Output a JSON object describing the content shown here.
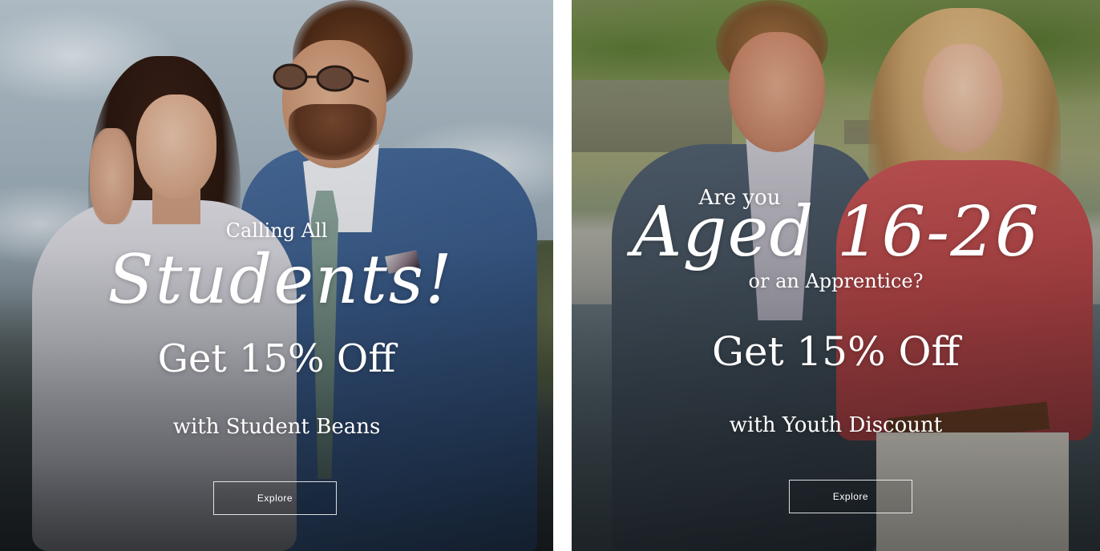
{
  "promos": [
    {
      "eyebrow": "Calling All",
      "headline": "Students!",
      "offer": "Get 15% Off",
      "subtext": "with Student Beans",
      "button_label": "Explore"
    },
    {
      "eyebrow": "Are you",
      "headline": "Aged 16-26",
      "eyebrow_2": "or an Apprentice?",
      "offer": "Get 15% Off",
      "subtext": "with Youth Discount",
      "button_label": "Explore"
    }
  ],
  "colors": {
    "text": "#ffffff",
    "button_border": "#ffffff",
    "page_background": "#ffffff"
  }
}
